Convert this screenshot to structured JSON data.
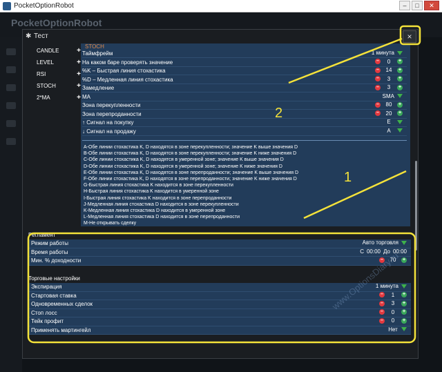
{
  "window": {
    "title": "PocketOptionRobot"
  },
  "app": {
    "brand": "PocketOptionRobot"
  },
  "dialog": {
    "title": "Тест",
    "close_label": "×",
    "menu": [
      {
        "label": "CANDLE"
      },
      {
        "label": "LEVEL"
      },
      {
        "label": "RSI"
      },
      {
        "label": "STOCH"
      },
      {
        "label": "2*MA"
      }
    ],
    "stoch": {
      "section_label": "STOCH",
      "rows": [
        {
          "label": "Таймфрейм",
          "value": "1 минута"
        },
        {
          "label": "На каком баре проверять значение",
          "value": "0"
        },
        {
          "label": "%K – Быстрая линия стохастика",
          "value": "14"
        },
        {
          "label": "%D – Медленная линия стохастика",
          "value": "3"
        },
        {
          "label": "Замедление",
          "value": "3"
        },
        {
          "label": "MA",
          "value": "SMA"
        },
        {
          "label": "Зона перекупленности",
          "value": "80"
        },
        {
          "label": "Зона перепроданности",
          "value": "20"
        },
        {
          "label": "↑ Сигнал на покупку",
          "value": "E"
        },
        {
          "label": "↓ Сигнал на продажу",
          "value": "A"
        }
      ],
      "descriptions": [
        "A-Обе линии стохастика K, D находятся в зоне перекупленности; значение K выше значения D",
        "B-Обе линии стохастика K, D находятся в зоне перекупленности; значение K ниже значения D",
        "C-Обе линии стохастика K, D находятся в умеренной зоне; значение K выше значения D",
        "D-Обе линии стохастика K, D находятся в умеренной зоне; значение K ниже значения D",
        "E-Обе линии стохастика K, D находятся в зоне перепроданности; значение K выше значения D",
        "F-Обе линии стохастика K, D находятся в зоне перепроданности; значение K ниже значения D",
        "G-Быстрая линия стохастика K находится в зоне перекупленности",
        "H-Быстрая линия стохастика K находится в умеренной зоне",
        "I-Быстрая линия стохастика K находится в зоне перепроданности",
        "J-Медленная линия стохастика D находится в зоне перекупленности",
        "K-Медленная линия стохастика D находится в умеренной зоне",
        "L-Медленная линия стохастика D находится в зоне перепроданности",
        "M-Не открывать сделку"
      ]
    },
    "reglament": {
      "heading": "Регламент",
      "mode_label": "Режим работы",
      "mode_value": "Авто торговля",
      "time_label": "Время работы",
      "time_from_prefix": "С",
      "time_from": "00:00",
      "time_to_prefix": "До",
      "time_to": "00:00",
      "min_profit_label": "Мин. % доходности",
      "min_profit_value": "70"
    },
    "trade": {
      "heading": "Торговые настройки",
      "expiration_label": "Экспирация",
      "expiration_value": "1 минута",
      "start_bet_label": "Стартовая ставка",
      "start_bet_value": "1",
      "concurrent_label": "Одновременных сделок",
      "concurrent_value": "3",
      "stop_loss_label": "Стоп лосс",
      "stop_loss_value": "0",
      "take_profit_label": "Тейк профит",
      "take_profit_value": "0",
      "martingale_label": "Применять мартингейл",
      "martingale_value": "Нет"
    }
  },
  "annotations": {
    "label_1": "1",
    "label_2": "2",
    "watermark": "www.OptionsDiary.ru"
  },
  "colors": {
    "panel": "#223c5a",
    "highlight": "#f4e23a",
    "minus": "#e2393f",
    "plus": "#3aa75a"
  }
}
